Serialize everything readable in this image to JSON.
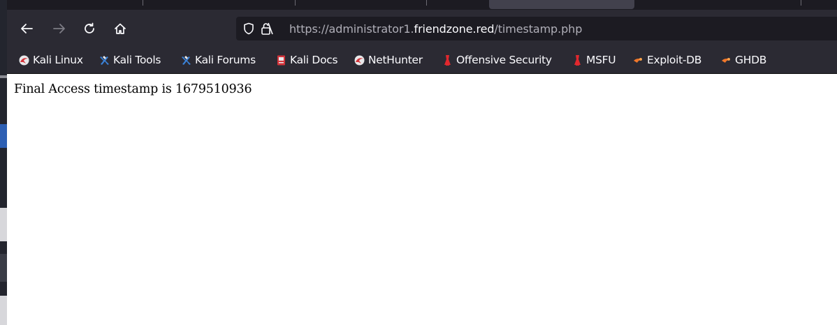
{
  "browser": {
    "url": {
      "prefix": "https://administrator1.",
      "domain": "friendzone.red",
      "path": "/timestamp.php"
    }
  },
  "bookmarks": [
    {
      "label": "Kali Linux",
      "icon": "kali-dragon-icon"
    },
    {
      "label": "Kali Tools",
      "icon": "kali-tools-icon"
    },
    {
      "label": "Kali Forums",
      "icon": "kali-tools-icon"
    },
    {
      "label": "Kali Docs",
      "icon": "kali-docs-icon"
    },
    {
      "label": "NetHunter",
      "icon": "kali-dragon-icon"
    },
    {
      "label": "Offensive Security",
      "icon": "offsec-icon"
    },
    {
      "label": "MSFU",
      "icon": "offsec-icon"
    },
    {
      "label": "Exploit-DB",
      "icon": "exploitdb-icon"
    },
    {
      "label": "GHDB",
      "icon": "exploitdb-icon"
    }
  ],
  "page": {
    "text": "Final Access timestamp is 1679510936"
  },
  "colors": {
    "toolbar": "#2b2a33",
    "urlbar": "#1c1b22",
    "content_bg": "#ffffff"
  }
}
